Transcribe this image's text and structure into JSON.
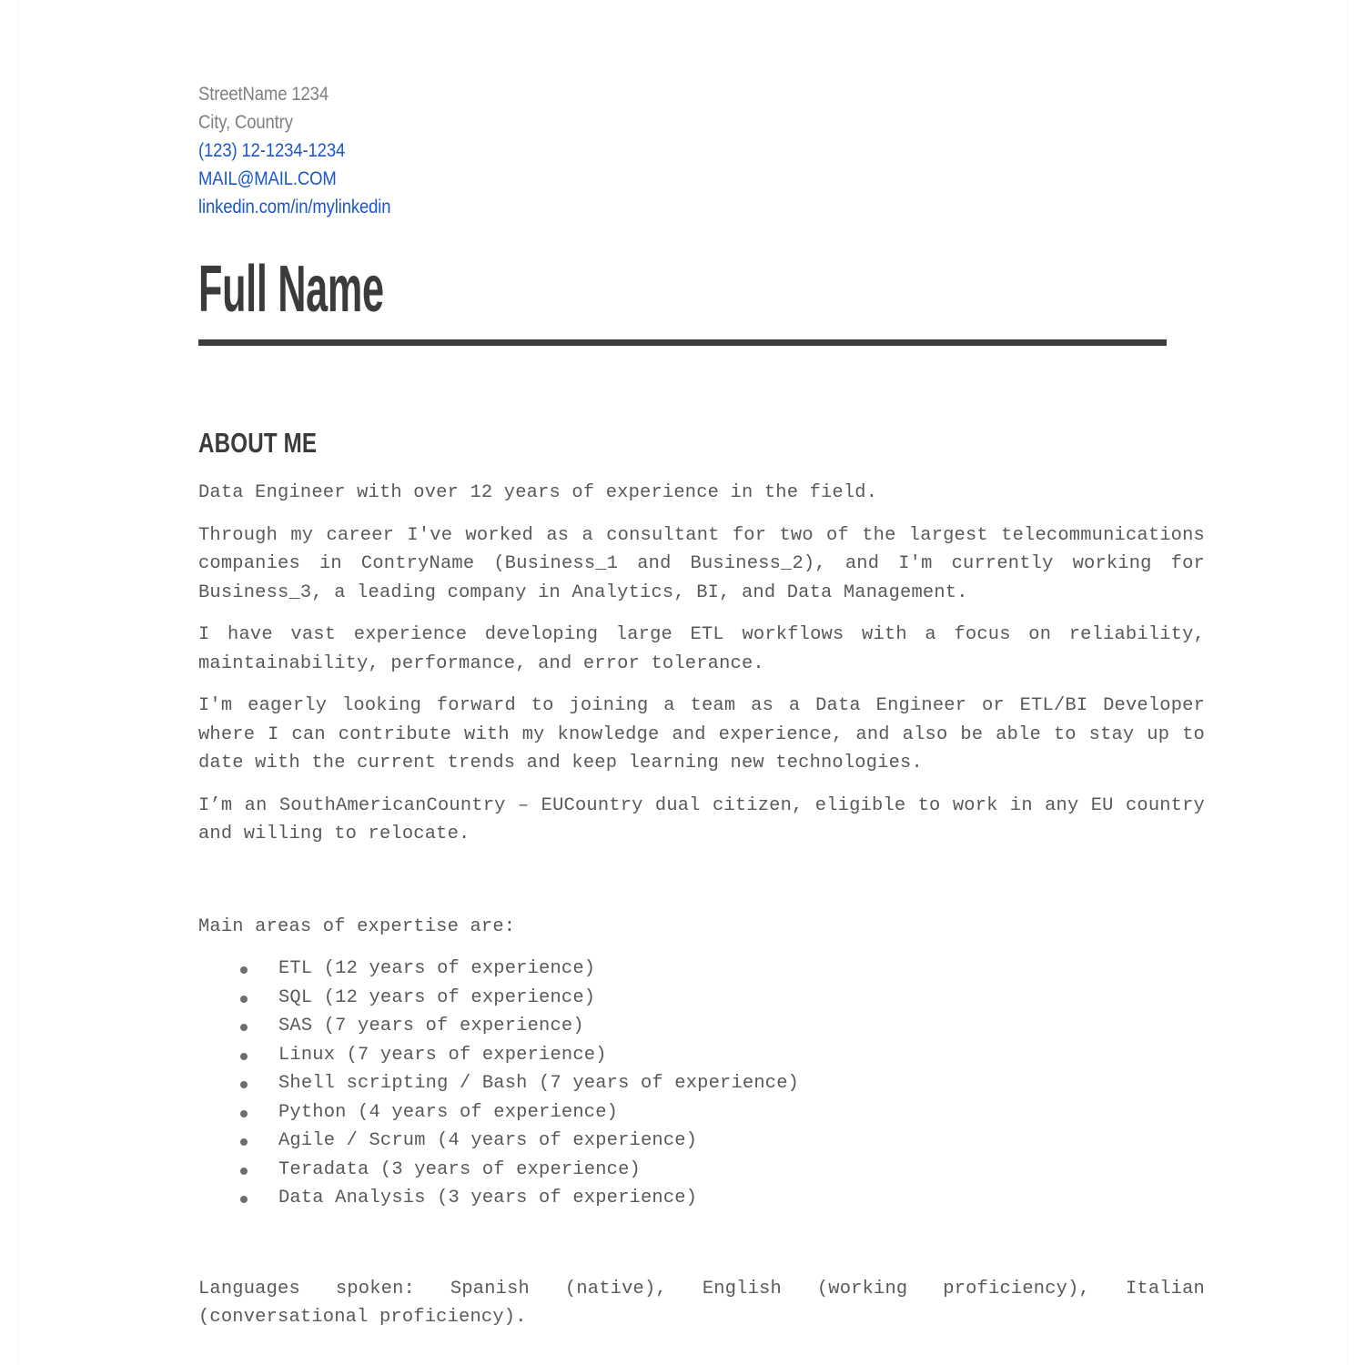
{
  "contact": {
    "street": "StreetName 1234",
    "city": "City, Country",
    "phone": "(123) 12-1234-1234",
    "email": "MAIL@MAIL.COM",
    "linkedin": "linkedin.com/in/mylinkedin",
    "address_color": "#7f7f7f",
    "link_color": "#1a57c8"
  },
  "name": "Full Name",
  "rule_color": "#3d3d3d",
  "sections": {
    "about": {
      "heading": "ABOUT ME",
      "paragraphs": [
        "Data Engineer with over 12 years of experience in the field.",
        "Through my career I've worked as a consultant for two of the largest telecommunications companies in ContryName (Business_1 and Business_2), and I'm currently working for Business_3, a leading company in Analytics, BI, and Data Management.",
        "I have vast experience developing large ETL workflows with a focus on reliability, maintainability, performance, and error tolerance.",
        "I'm eagerly looking forward to joining a team as a Data Engineer or ETL/BI Developer where I can contribute with my knowledge and experience, and also be able to stay up to date with the current trends and keep learning new technologies.",
        "I’m an SouthAmericanCountry – EUCountry dual citizen, eligible to work in any EU country and willing to relocate."
      ],
      "expertise_intro": "Main areas of expertise are:",
      "expertise": [
        "ETL (12 years of experience)",
        "SQL (12 years of experience)",
        "SAS (7 years of experience)",
        "Linux (7 years of experience)",
        "Shell scripting / Bash (7 years of experience)",
        "Python (4 years of experience)",
        "Agile / Scrum (4 years of experience)",
        "Teradata (3 years of experience)",
        "Data Analysis (3 years of experience)"
      ],
      "languages": "Languages spoken: Spanish (native), English (working proficiency), Italian (conversational proficiency)."
    }
  }
}
